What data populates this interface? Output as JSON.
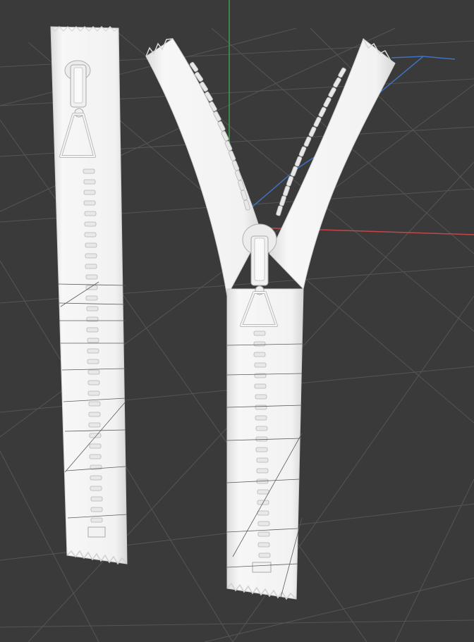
{
  "viewport": {
    "background": "#3a3a3a",
    "grid_color": "#545454",
    "axes": {
      "x_color": "#c24848",
      "y_color": "#3f9c4a",
      "z_color": "#3f72c2"
    }
  },
  "objects": [
    {
      "name": "zipper-closed",
      "material_color": "#f4f4f4",
      "state": "closed"
    },
    {
      "name": "zipper-open",
      "material_color": "#f4f4f4",
      "state": "partially open"
    }
  ]
}
